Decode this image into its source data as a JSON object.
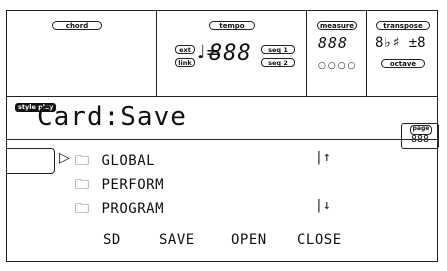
{
  "header": {
    "chord_label": "chord",
    "tempo_label": "tempo",
    "ext_label": "ext",
    "link_label": "link",
    "seq1_label": "seq 1",
    "seq2_label": "seq 2",
    "tempo_value": "888",
    "note_glyph": "♩=",
    "measure_label": "measure",
    "measure_value": "888",
    "measure_dots": "○○○○",
    "transpose_label": "transpose",
    "transpose_value": "8♭♯ ±8",
    "octave_label": "octave"
  },
  "mode_badge": "style play",
  "title": "Card:Save",
  "page": {
    "label": "page",
    "value": "888"
  },
  "list": {
    "selector_arrow": "▷",
    "items": [
      {
        "icon": "folder-icon",
        "label": "GLOBAL",
        "scroll": "|↑"
      },
      {
        "icon": "folder-icon",
        "label": "PERFORM",
        "scroll": ""
      },
      {
        "icon": "folder-icon",
        "label": "PROGRAM",
        "scroll": "|↓"
      }
    ]
  },
  "buttons": {
    "sd": "SD",
    "save": "SAVE",
    "open": "OPEN",
    "close": "CLOSE"
  }
}
